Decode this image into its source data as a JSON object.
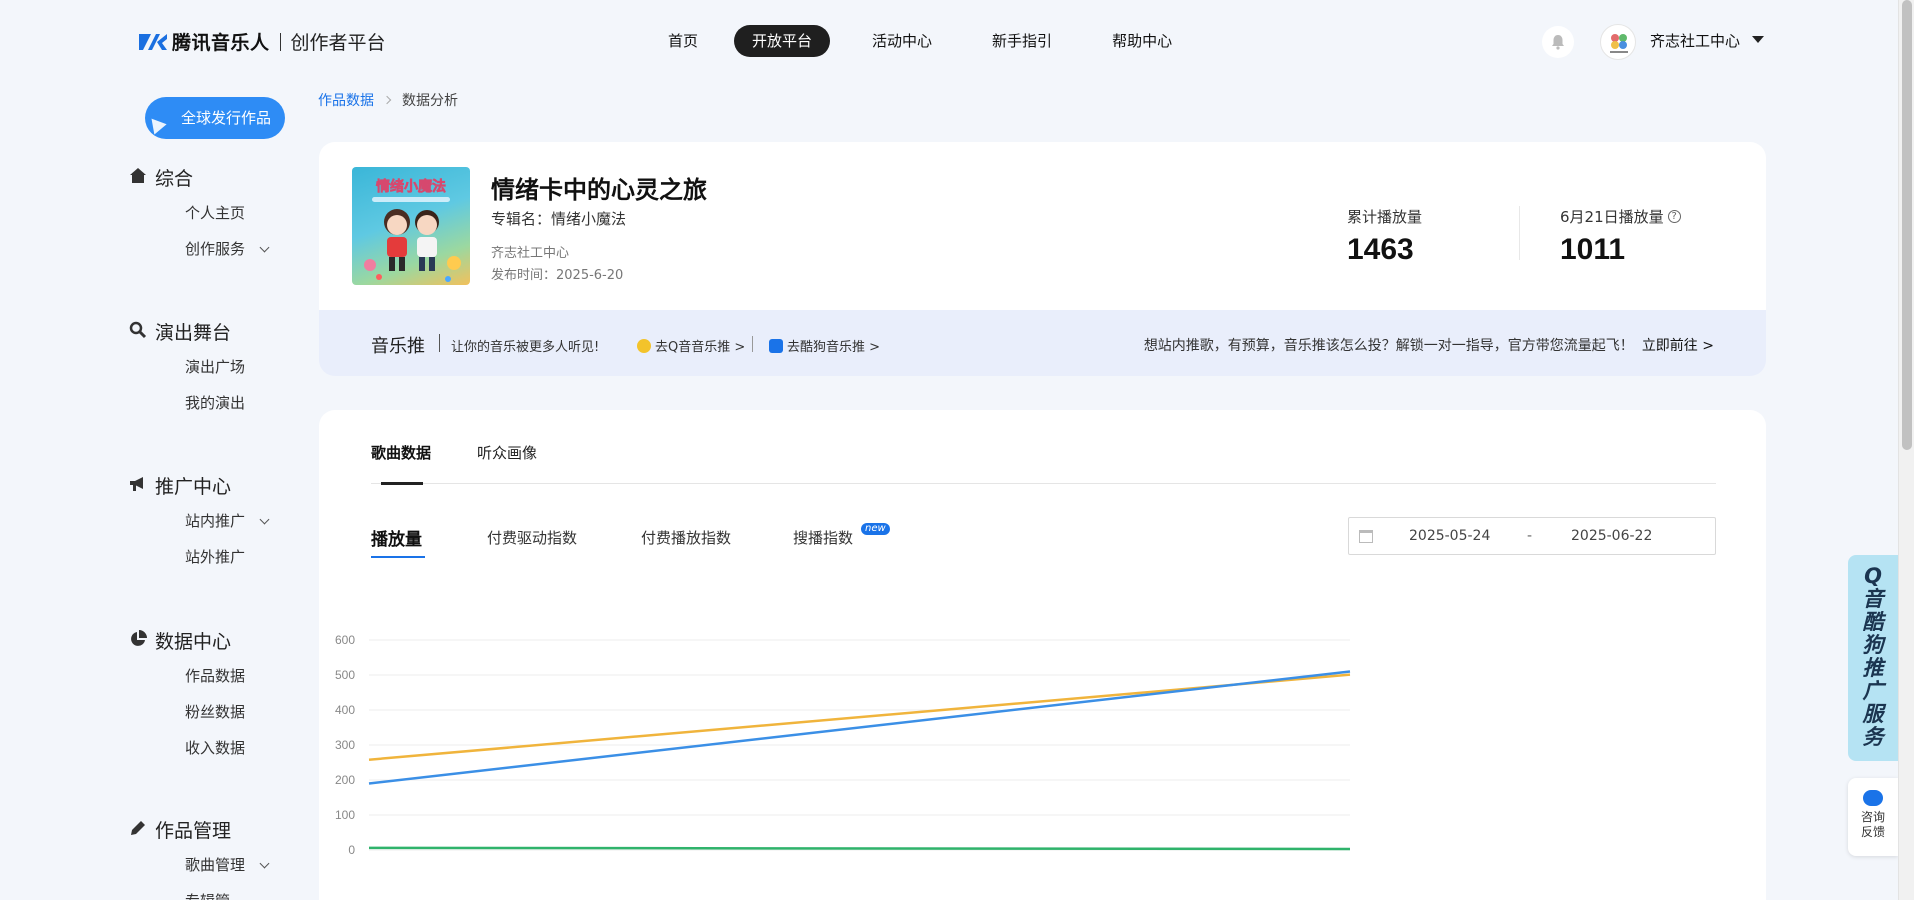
{
  "header": {
    "logo_text": "腾讯音乐人",
    "logo_sub": "创作者平台",
    "nav": [
      {
        "label": "首页",
        "active": false
      },
      {
        "label": "开放平台",
        "active": true
      },
      {
        "label": "活动中心",
        "active": false
      },
      {
        "label": "新手指引",
        "active": false
      },
      {
        "label": "帮助中心",
        "active": false
      }
    ],
    "user_name": "齐志社工中心"
  },
  "sidebar": {
    "publish_label": "全球发行作品",
    "sections": [
      {
        "title": "综合",
        "icon": "home-icon",
        "items": [
          {
            "label": "个人主页"
          },
          {
            "label": "创作服务",
            "expandable": true
          }
        ]
      },
      {
        "title": "演出舞台",
        "icon": "search-icon",
        "items": [
          {
            "label": "演出广场"
          },
          {
            "label": "我的演出"
          }
        ]
      },
      {
        "title": "推广中心",
        "icon": "megaphone-icon",
        "items": [
          {
            "label": "站内推广",
            "expandable": true
          },
          {
            "label": "站外推广"
          }
        ]
      },
      {
        "title": "数据中心",
        "icon": "pie-chart-icon",
        "items": [
          {
            "label": "作品数据"
          },
          {
            "label": "粉丝数据"
          },
          {
            "label": "收入数据"
          }
        ]
      },
      {
        "title": "作品管理",
        "icon": "pencil-icon",
        "items": [
          {
            "label": "歌曲管理",
            "expandable": true
          },
          {
            "label": "专辑管"
          }
        ]
      }
    ]
  },
  "breadcrumb": {
    "parent": "作品数据",
    "current": "数据分析"
  },
  "song": {
    "title": "情绪卡中的心灵之旅",
    "album": "专辑名：情绪小魔法",
    "artist": "齐志社工中心",
    "release": "发布时间：2025-6-20",
    "cover_text": "情绪小魔法"
  },
  "stats": {
    "total_label": "累计播放量",
    "total_value": "1463",
    "day_label": "6月21日播放量",
    "day_value": "1011",
    "help": "?"
  },
  "promo": {
    "title": "音乐推",
    "slogan": "让你的音乐被更多人听见!",
    "link_q": "去Q音音乐推 >",
    "link_k": "去酷狗音乐推 >",
    "right_text": "想站内推歌，有预算，音乐推该怎么投？解锁一对一指导，官方带您流量起飞！",
    "go": "立即前往 >"
  },
  "tabs": [
    {
      "label": "歌曲数据",
      "active": true
    },
    {
      "label": "听众画像",
      "active": false
    }
  ],
  "subtabs": [
    {
      "label": "播放量",
      "active": true
    },
    {
      "label": "付费驱动指数",
      "active": false
    },
    {
      "label": "付费播放指数",
      "active": false
    },
    {
      "label": "搜播指数",
      "active": false,
      "badge": "new"
    }
  ],
  "date_range": {
    "start": "2025-05-24",
    "separator": "-",
    "end": "2025-06-22"
  },
  "chart_data": {
    "type": "line",
    "yticks": [
      "600",
      "500",
      "400",
      "300",
      "200",
      "100",
      "0"
    ],
    "ylim": [
      0,
      600
    ],
    "series": [
      {
        "color": "#f0b43c",
        "values": [
          258,
          501
        ]
      },
      {
        "color": "#3b8fe6",
        "values": [
          190,
          510
        ]
      },
      {
        "color": "#2fb36b",
        "values": [
          6,
          3
        ]
      }
    ]
  },
  "floating": {
    "promo_chars": [
      "Q",
      "音",
      "酷",
      "狗",
      "推",
      "广",
      "服",
      "务"
    ],
    "help_label_1": "咨询",
    "help_label_2": "反馈"
  }
}
